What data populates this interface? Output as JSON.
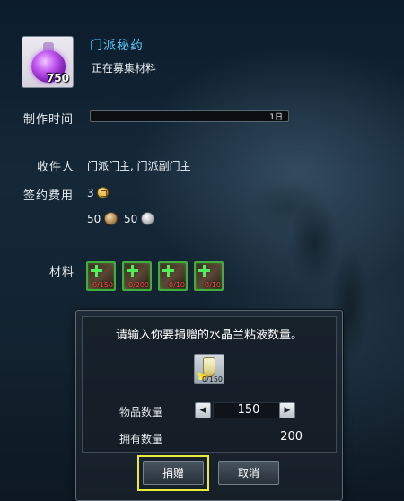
{
  "item": {
    "name": "门派秘药",
    "status": "正在募集材料",
    "quantity": "750",
    "icon": "purple-potion-icon"
  },
  "craft_time": {
    "label": "制作时间",
    "value": "1日",
    "progress": 0
  },
  "recipient": {
    "label": "收件人",
    "value": "门派门主, 门派副门主"
  },
  "contract_fee": {
    "label": "签约费用",
    "gold": "3",
    "bronze": "50",
    "silver": "50"
  },
  "materials": {
    "label": "材料",
    "slots": [
      {
        "count": "0/150"
      },
      {
        "count": "0/200"
      },
      {
        "count": "0/10"
      },
      {
        "count": "0/10"
      }
    ]
  },
  "dialog": {
    "prompt": "请输入你要捐赠的水晶兰粘液数量。",
    "item_count": "0/150",
    "quantity_label": "物品数量",
    "quantity_value": "150",
    "owned_label": "拥有数量",
    "owned_value": "200",
    "decrease_glyph": "◀",
    "increase_glyph": "▶",
    "donate_label": "捐赠",
    "cancel_label": "取消",
    "highlight_color": "#e9ea3a"
  }
}
